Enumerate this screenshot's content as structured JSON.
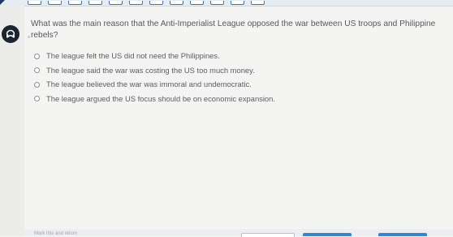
{
  "quiz": {
    "progress_segments": [
      1,
      2,
      3,
      4,
      5,
      6,
      7,
      8,
      9,
      10,
      11,
      12
    ],
    "question_text": "What was the main reason that the Anti-Imperialist League opposed the war between US troops and Philippine rebels?",
    "options": [
      {
        "label": "The league felt the US did not need the Philippines."
      },
      {
        "label": "The league said the war was costing the US too much money."
      },
      {
        "label": "The league believed the war was immoral and undemocratic."
      },
      {
        "label": "The league argued the US focus should be on economic expansion."
      }
    ],
    "footer": {
      "mark_link": "Mark this and return"
    }
  },
  "icons": {
    "audio": "speaker-icon"
  },
  "colors": {
    "accent": "#3b86c8",
    "text": "#54585d",
    "background": "#f4f4f2",
    "audio_button": "#1c2430"
  }
}
